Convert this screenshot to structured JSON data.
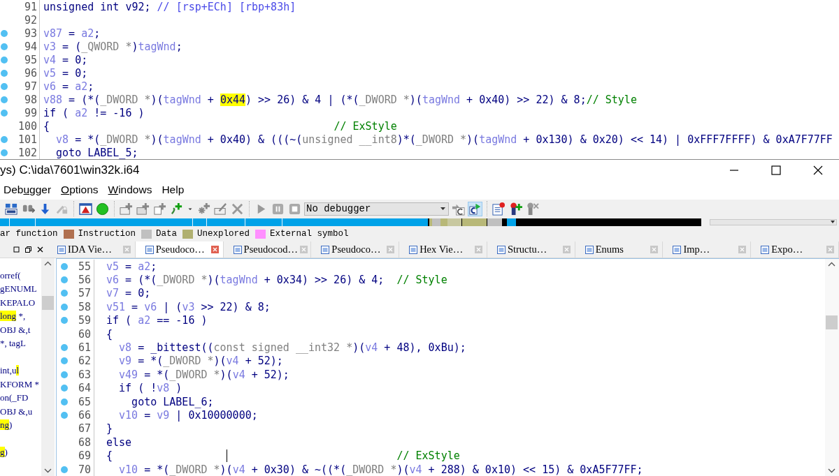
{
  "top_pane": {
    "lines": [
      {
        "n": "91",
        "dot": false,
        "segs": [
          {
            "kind": "plain",
            "text": "unsigned int v92; "
          },
          {
            "kind": "note",
            "text": "// [rsp+ECh] [rbp+83h]"
          }
        ]
      },
      {
        "n": "92",
        "dot": false
      },
      {
        "n": "93",
        "dot": true,
        "segs": [
          {
            "kind": "var",
            "text": "v87"
          },
          {
            "kind": "plain",
            "text": " = "
          },
          {
            "kind": "var",
            "text": "a2"
          },
          {
            "kind": "plain",
            "text": ";"
          }
        ]
      },
      {
        "n": "94",
        "dot": true,
        "segs": [
          {
            "kind": "var",
            "text": "v3"
          },
          {
            "kind": "plain",
            "text": " = ("
          },
          {
            "kind": "type",
            "text": "_QWORD *"
          },
          {
            "kind": "plain",
            "text": ")"
          },
          {
            "kind": "var",
            "text": "tagWnd"
          },
          {
            "kind": "plain",
            "text": ";"
          }
        ]
      },
      {
        "n": "95",
        "dot": true,
        "segs": [
          {
            "kind": "var",
            "text": "v4"
          },
          {
            "kind": "plain",
            "text": " = 0;"
          }
        ]
      },
      {
        "n": "96",
        "dot": true,
        "segs": [
          {
            "kind": "var",
            "text": "v5"
          },
          {
            "kind": "plain",
            "text": " = 0;"
          }
        ]
      },
      {
        "n": "97",
        "dot": true,
        "segs": [
          {
            "kind": "var",
            "text": "v6"
          },
          {
            "kind": "plain",
            "text": " = "
          },
          {
            "kind": "var",
            "text": "a2"
          },
          {
            "kind": "plain",
            "text": ";"
          }
        ]
      },
      {
        "n": "98",
        "dot": true,
        "segs": [
          {
            "kind": "var",
            "text": "v88"
          },
          {
            "kind": "plain",
            "text": " = (*("
          },
          {
            "kind": "type",
            "text": "_DWORD *"
          },
          {
            "kind": "plain",
            "text": ")("
          },
          {
            "kind": "var",
            "text": "tagWnd"
          },
          {
            "kind": "plain",
            "text": " + "
          },
          {
            "kind": "mark",
            "text": "0x44"
          },
          {
            "kind": "plain",
            "text": ") >> 26) & 4 | (*("
          },
          {
            "kind": "type",
            "text": "_DWORD *"
          },
          {
            "kind": "plain",
            "text": ")("
          },
          {
            "kind": "var",
            "text": "tagWnd"
          },
          {
            "kind": "plain",
            "text": " + 0x40) >> 22) & 8;"
          },
          {
            "kind": "comment",
            "text": "// Style"
          }
        ]
      },
      {
        "n": "99",
        "dot": true,
        "segs": [
          {
            "kind": "plain",
            "text": "if ( "
          },
          {
            "kind": "var",
            "text": "a2"
          },
          {
            "kind": "plain",
            "text": " != -16 )"
          }
        ]
      },
      {
        "n": "100",
        "dot": false,
        "segs": [
          {
            "kind": "plain",
            "text": "{                                             "
          },
          {
            "kind": "comment",
            "text": "// ExStyle"
          }
        ]
      },
      {
        "n": "101",
        "dot": true,
        "segs": [
          {
            "kind": "var",
            "text": "  v8"
          },
          {
            "kind": "plain",
            "text": " = *("
          },
          {
            "kind": "type",
            "text": "_DWORD *"
          },
          {
            "kind": "plain",
            "text": ")("
          },
          {
            "kind": "var",
            "text": "tagWnd"
          },
          {
            "kind": "plain",
            "text": " + 0x40) & (((~("
          },
          {
            "kind": "type",
            "text": "unsigned __int8"
          },
          {
            "kind": "plain",
            "text": ")*("
          },
          {
            "kind": "type",
            "text": "_DWORD *"
          },
          {
            "kind": "plain",
            "text": ")("
          },
          {
            "kind": "var",
            "text": "tagWnd"
          },
          {
            "kind": "plain",
            "text": " + 0x130) & 0x20) << 14) | 0xFFF7FFFF) & 0xA7F77FF"
          }
        ]
      },
      {
        "n": "102",
        "dot": true,
        "segs": [
          {
            "kind": "plain",
            "text": "  goto LABEL_5;"
          }
        ]
      }
    ]
  },
  "window": {
    "title": "ys) C:\\ida\\7601\\win32k.i64"
  },
  "menu": [
    {
      "pre": "Deb",
      "key": "u",
      "post": "gger"
    },
    {
      "key": "O",
      "post": "ptions"
    },
    {
      "key": "W",
      "post": "indows"
    },
    {
      "pre": "Help"
    }
  ],
  "toolbar": [
    [
      {
        "kind": "hex",
        "selected": false
      },
      {
        "kind": "binoculars",
        "selected": false
      },
      {
        "kind": "down-arrow",
        "selected": false
      },
      {
        "kind": "lock",
        "selected": false
      }
    ],
    [
      {
        "kind": "warning",
        "selected": false
      },
      {
        "kind": "circle",
        "selected": false
      }
    ],
    [
      {
        "kind": "add-code",
        "selected": false
      },
      {
        "kind": "add-data",
        "selected": false
      },
      {
        "kind": "add-text",
        "selected": false
      },
      {
        "kind": "add-symbol",
        "selected": false
      },
      {
        "kind": "caret",
        "selected": false
      },
      {
        "kind": "add-star",
        "selected": false
      },
      {
        "kind": "edit",
        "selected": false
      },
      {
        "kind": "delete",
        "selected": false
      }
    ],
    [
      {
        "kind": "play",
        "selected": false
      },
      {
        "kind": "pause",
        "selected": false
      },
      {
        "kind": "stop",
        "selected": false
      },
      {
        "kind": "dropdown",
        "value": "No debugger",
        "selected": false
      },
      {
        "kind": "jump-c",
        "selected": false
      },
      {
        "kind": "run-c",
        "selected": true
      }
    ],
    [
      {
        "kind": "list",
        "selected": false
      },
      {
        "kind": "pin-add",
        "selected": false
      },
      {
        "kind": "pin-remove",
        "selected": false
      }
    ]
  ],
  "legend": [
    {
      "label": "ar function"
    },
    {
      "label": "Instruction",
      "color": "#b07050"
    },
    {
      "label": "Data",
      "color": "#c0c0c0"
    },
    {
      "label": "Unexplored",
      "color": "#b0b070"
    },
    {
      "label": "External symbol",
      "color": "#ff90ff"
    }
  ],
  "tabs": [
    {
      "label": "IDA Vie…",
      "selected": false
    },
    {
      "label": "Pseudoco…",
      "selected": true
    },
    {
      "label": "Pseudocod…",
      "selected": false
    },
    {
      "label": "Pseudoco…",
      "selected": false
    },
    {
      "label": "Hex Vie…",
      "selected": false
    },
    {
      "label": "Structu…",
      "selected": false
    },
    {
      "label": "Enums",
      "selected": false
    },
    {
      "label": "Imp…",
      "selected": false
    },
    {
      "label": "Expo…",
      "selected": false
    }
  ],
  "side_panel": {
    "groups": [
      [
        {
          "segs": [
            {
              "kind": "plain",
              "text": "orref("
            }
          ]
        },
        {
          "segs": [
            {
              "kind": "plain",
              "text": "gENUML"
            }
          ]
        },
        {
          "segs": [
            {
              "kind": "plain",
              "text": "KEPALO"
            }
          ]
        },
        {
          "segs": [
            {
              "kind": "mark",
              "text": "long"
            },
            {
              "kind": "plain",
              "text": " *,"
            }
          ]
        },
        {
          "segs": [
            {
              "kind": "plain",
              "text": "OBJ &,t"
            }
          ]
        },
        {
          "segs": [
            {
              "kind": "plain",
              "text": "*, tagL"
            }
          ]
        }
      ],
      [
        {
          "segs": [
            {
              "kind": "plain",
              "text": "int,u"
            },
            {
              "kind": "mark",
              "text": "l"
            }
          ]
        },
        {
          "segs": [
            {
              "kind": "plain",
              "text": "KFORM *"
            }
          ]
        },
        {
          "segs": [
            {
              "kind": "plain",
              "text": "on(_FD"
            }
          ]
        },
        {
          "segs": [
            {
              "kind": "plain",
              "text": "OBJ &,u"
            }
          ]
        },
        {
          "segs": [
            {
              "kind": "mark",
              "text": "ng"
            },
            {
              "kind": "plain",
              "text": ")"
            }
          ]
        }
      ],
      [
        {
          "segs": [
            {
              "kind": "mark",
              "text": "g"
            },
            {
              "kind": "plain",
              "text": ")"
            }
          ]
        }
      ]
    ]
  },
  "code_pane": {
    "lines": [
      {
        "n": "55",
        "dot": true,
        "segs": [
          {
            "kind": "var",
            "text": "v5"
          },
          {
            "kind": "plain",
            "text": " = "
          },
          {
            "kind": "var",
            "text": "a2"
          },
          {
            "kind": "plain",
            "text": ";"
          }
        ]
      },
      {
        "n": "56",
        "dot": true,
        "segs": [
          {
            "kind": "var",
            "text": "v6"
          },
          {
            "kind": "plain",
            "text": " = (*("
          },
          {
            "kind": "type",
            "text": "_DWORD *"
          },
          {
            "kind": "plain",
            "text": ")("
          },
          {
            "kind": "var",
            "text": "tagWnd"
          },
          {
            "kind": "plain",
            "text": " + 0x34) >> 26) & 4;  "
          },
          {
            "kind": "comment",
            "text": "// Style"
          }
        ]
      },
      {
        "n": "57",
        "dot": true,
        "segs": [
          {
            "kind": "var",
            "text": "v7"
          },
          {
            "kind": "plain",
            "text": " = 0;"
          }
        ]
      },
      {
        "n": "58",
        "dot": true,
        "segs": [
          {
            "kind": "var",
            "text": "v51"
          },
          {
            "kind": "plain",
            "text": " = "
          },
          {
            "kind": "var",
            "text": "v6"
          },
          {
            "kind": "plain",
            "text": " | ("
          },
          {
            "kind": "var",
            "text": "v3"
          },
          {
            "kind": "plain",
            "text": " >> 22) & 8;"
          }
        ]
      },
      {
        "n": "59",
        "dot": true,
        "segs": [
          {
            "kind": "plain",
            "text": "if ( "
          },
          {
            "kind": "var",
            "text": "a2"
          },
          {
            "kind": "plain",
            "text": " == -16 )"
          }
        ]
      },
      {
        "n": "60",
        "dot": false,
        "segs": [
          {
            "kind": "plain",
            "text": "{"
          }
        ]
      },
      {
        "n": "61",
        "dot": true,
        "segs": [
          {
            "kind": "var",
            "text": "  v8"
          },
          {
            "kind": "plain",
            "text": " = _bittest(("
          },
          {
            "kind": "type",
            "text": "const signed __int32 *"
          },
          {
            "kind": "plain",
            "text": ")("
          },
          {
            "kind": "var",
            "text": "v4"
          },
          {
            "kind": "plain",
            "text": " + 48), 0xBu);"
          }
        ]
      },
      {
        "n": "62",
        "dot": true,
        "segs": [
          {
            "kind": "var",
            "text": "  v9"
          },
          {
            "kind": "plain",
            "text": " = *("
          },
          {
            "kind": "type",
            "text": "_DWORD *"
          },
          {
            "kind": "plain",
            "text": ")("
          },
          {
            "kind": "var",
            "text": "v4"
          },
          {
            "kind": "plain",
            "text": " + 52);"
          }
        ]
      },
      {
        "n": "63",
        "dot": true,
        "segs": [
          {
            "kind": "var",
            "text": "  v49"
          },
          {
            "kind": "plain",
            "text": " = *("
          },
          {
            "kind": "type",
            "text": "_DWORD *"
          },
          {
            "kind": "plain",
            "text": ")("
          },
          {
            "kind": "var",
            "text": "v4"
          },
          {
            "kind": "plain",
            "text": " + 52);"
          }
        ]
      },
      {
        "n": "64",
        "dot": true,
        "segs": [
          {
            "kind": "plain",
            "text": "  if ( !"
          },
          {
            "kind": "var",
            "text": "v8"
          },
          {
            "kind": "plain",
            "text": " )"
          }
        ]
      },
      {
        "n": "65",
        "dot": true,
        "segs": [
          {
            "kind": "plain",
            "text": "    goto LABEL_6;"
          }
        ]
      },
      {
        "n": "66",
        "dot": true,
        "segs": [
          {
            "kind": "var",
            "text": "  v10"
          },
          {
            "kind": "plain",
            "text": " = "
          },
          {
            "kind": "var",
            "text": "v9"
          },
          {
            "kind": "plain",
            "text": " | 0x10000000;"
          }
        ]
      },
      {
        "n": "67",
        "dot": false,
        "segs": [
          {
            "kind": "plain",
            "text": "}"
          }
        ]
      },
      {
        "n": "68",
        "dot": false,
        "segs": [
          {
            "kind": "plain",
            "text": "else"
          }
        ]
      },
      {
        "n": "69",
        "dot": false,
        "segs": [
          {
            "kind": "plain",
            "text": "{                                             "
          },
          {
            "kind": "comment",
            "text": "// ExStyle"
          }
        ]
      },
      {
        "n": "70",
        "dot": true,
        "segs": [
          {
            "kind": "var",
            "text": "  v10"
          },
          {
            "kind": "plain",
            "text": " = *("
          },
          {
            "kind": "type",
            "text": "_DWORD *"
          },
          {
            "kind": "plain",
            "text": ")("
          },
          {
            "kind": "var",
            "text": "v4"
          },
          {
            "kind": "plain",
            "text": " + 0x30) & ~((*("
          },
          {
            "kind": "type",
            "text": "_DWORD *"
          },
          {
            "kind": "plain",
            "text": ")("
          },
          {
            "kind": "var",
            "text": "v4"
          },
          {
            "kind": "plain",
            "text": " + 288) & 0x10) << 15) & 0xA5F77FF;"
          }
        ]
      }
    ]
  }
}
